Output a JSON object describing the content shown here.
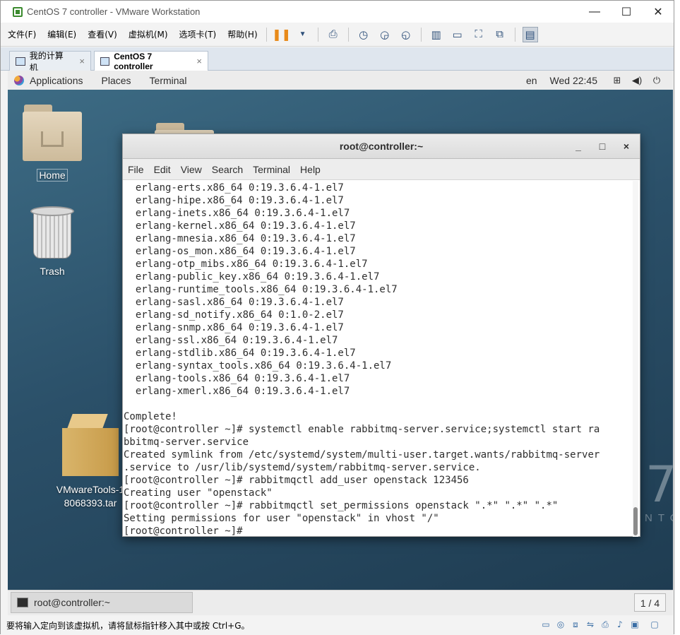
{
  "window": {
    "title": "CentOS 7 controller - VMware Workstation",
    "controls": {
      "minimize": "—",
      "maximize": "☐",
      "close": "✕"
    }
  },
  "menubar": {
    "items": [
      "文件(F)",
      "编辑(E)",
      "查看(V)",
      "虚拟机(M)",
      "选项卡(T)",
      "帮助(H)"
    ]
  },
  "tabs": [
    {
      "label": "我的计算机",
      "active": false,
      "close": "×"
    },
    {
      "label": "CentOS 7 controller",
      "active": true,
      "close": "×"
    }
  ],
  "gnome": {
    "applications": "Applications",
    "places": "Places",
    "terminal": "Terminal",
    "lang": "en",
    "clock": "Wed 22:45"
  },
  "desktop": {
    "home": "Home",
    "trash": "Trash",
    "vmtools_line1": "VMwareTools-1",
    "vmtools_line2": "8068393.tar",
    "watermark_7": "7",
    "watermark_text": "NTO"
  },
  "terminal": {
    "title": "root@controller:~",
    "controls": {
      "minimize": "_",
      "maximize": "□",
      "close": "×"
    },
    "menu": [
      "File",
      "Edit",
      "View",
      "Search",
      "Terminal",
      "Help"
    ],
    "output": "  erlang-erts.x86_64 0:19.3.6.4-1.el7\n  erlang-hipe.x86_64 0:19.3.6.4-1.el7\n  erlang-inets.x86_64 0:19.3.6.4-1.el7\n  erlang-kernel.x86_64 0:19.3.6.4-1.el7\n  erlang-mnesia.x86_64 0:19.3.6.4-1.el7\n  erlang-os_mon.x86_64 0:19.3.6.4-1.el7\n  erlang-otp_mibs.x86_64 0:19.3.6.4-1.el7\n  erlang-public_key.x86_64 0:19.3.6.4-1.el7\n  erlang-runtime_tools.x86_64 0:19.3.6.4-1.el7\n  erlang-sasl.x86_64 0:19.3.6.4-1.el7\n  erlang-sd_notify.x86_64 0:1.0-2.el7\n  erlang-snmp.x86_64 0:19.3.6.4-1.el7\n  erlang-ssl.x86_64 0:19.3.6.4-1.el7\n  erlang-stdlib.x86_64 0:19.3.6.4-1.el7\n  erlang-syntax_tools.x86_64 0:19.3.6.4-1.el7\n  erlang-tools.x86_64 0:19.3.6.4-1.el7\n  erlang-xmerl.x86_64 0:19.3.6.4-1.el7\n\nComplete!\n[root@controller ~]# systemctl enable rabbitmq-server.service;systemctl start ra\nbbitmq-server.service\nCreated symlink from /etc/systemd/system/multi-user.target.wants/rabbitmq-server\n.service to /usr/lib/systemd/system/rabbitmq-server.service.\n[root@controller ~]# rabbitmqctl add_user openstack 123456\nCreating user \"openstack\"\n[root@controller ~]# rabbitmqctl set_permissions openstack \".*\" \".*\" \".*\"\nSetting permissions for user \"openstack\" in vhost \"/\"\n[root@controller ~]# "
  },
  "taskbar": {
    "task_label": "root@controller:~",
    "workspace": "1 / 4"
  },
  "statusbar": {
    "hint": "要将输入定向到该虚拟机，请将鼠标指针移入其中或按 Ctrl+G。"
  }
}
